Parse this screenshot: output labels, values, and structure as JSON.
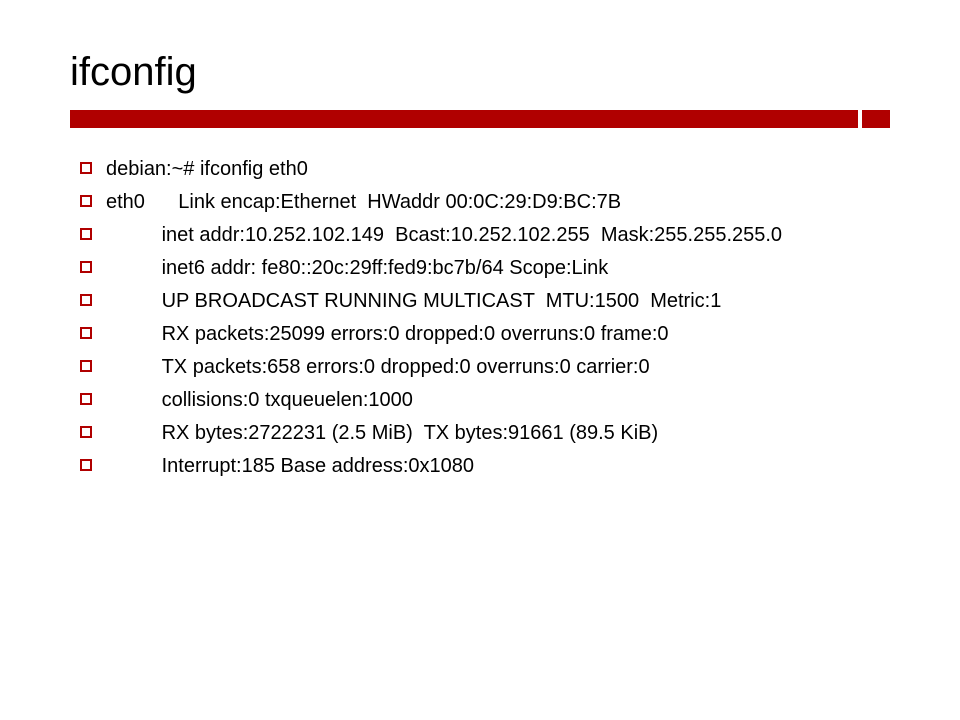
{
  "slide": {
    "title": "ifconfig",
    "lines": [
      "debian:~# ifconfig eth0",
      "eth0      Link encap:Ethernet  HWaddr 00:0C:29:D9:BC:7B",
      "          inet addr:10.252.102.149  Bcast:10.252.102.255  Mask:255.255.255.0",
      "          inet6 addr: fe80::20c:29ff:fed9:bc7b/64 Scope:Link",
      "          UP BROADCAST RUNNING MULTICAST  MTU:1500  Metric:1",
      "          RX packets:25099 errors:0 dropped:0 overruns:0 frame:0",
      "          TX packets:658 errors:0 dropped:0 overruns:0 carrier:0",
      "          collisions:0 txqueuelen:1000",
      "          RX bytes:2722231 (2.5 MiB)  TX bytes:91661 (89.5 KiB)",
      "          Interrupt:185 Base address:0x1080"
    ]
  },
  "colors": {
    "accent": "#b00000",
    "text": "#000000",
    "background": "#ffffff"
  }
}
